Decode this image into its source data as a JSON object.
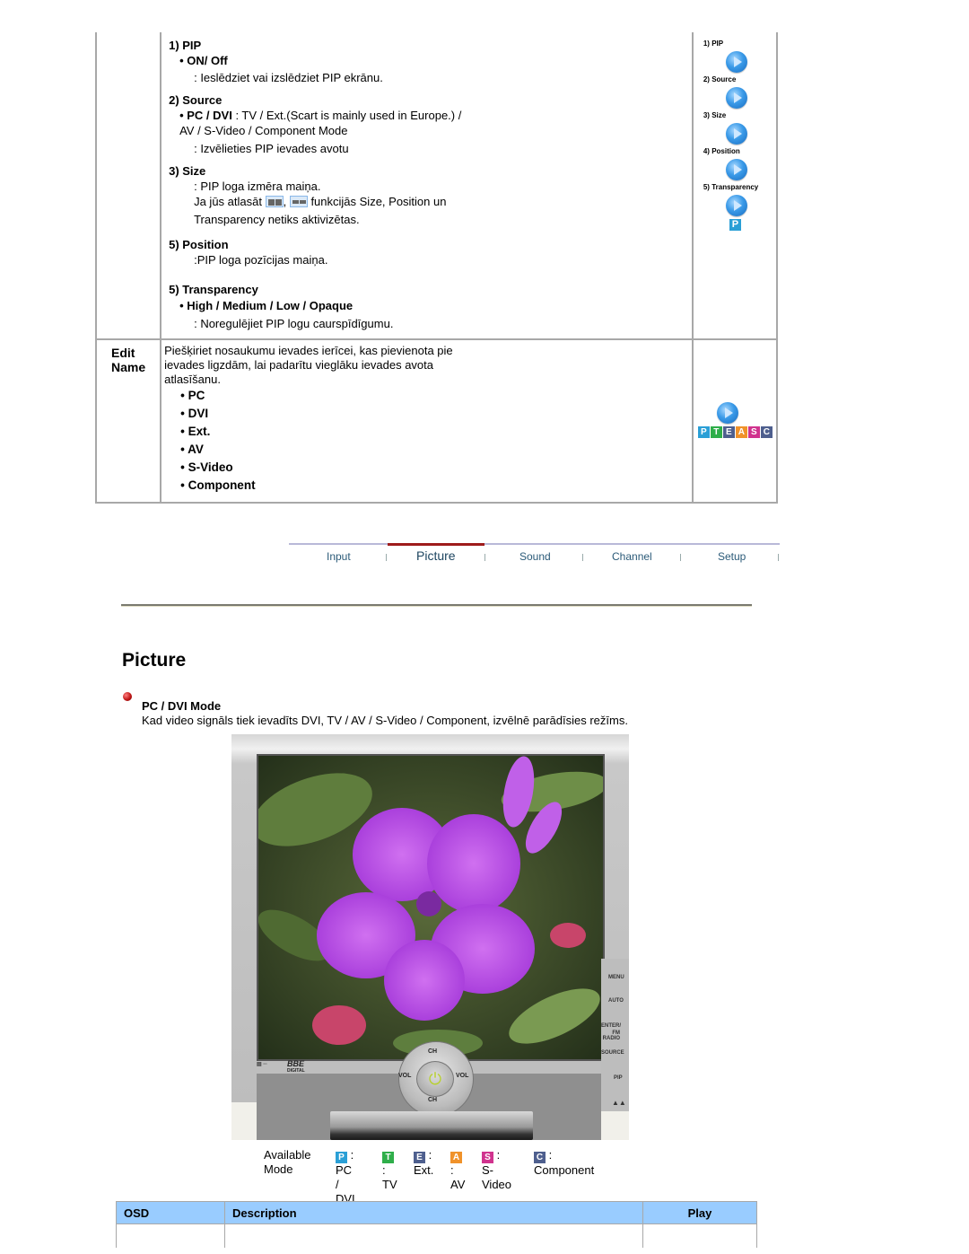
{
  "pip_table": {
    "rows": [
      {
        "label": "",
        "sections": {
          "pip": {
            "heading": "1) PIP",
            "option": "• ON/ Off",
            "desc": ": Ieslēdziet vai izslēdziet PIP ekrānu."
          },
          "source": {
            "heading": "2) Source",
            "option_bold": "• PC / DVI",
            "option_rest": " : TV / Ext.(Scart is mainly used in Europe.) /",
            "option_line2": "AV / S-Video / Component Mode",
            "desc": ": Izvēlieties PIP ievades avotu"
          },
          "size": {
            "heading": "3) Size",
            "desc": ": PIP loga izmēra maiņa.",
            "note_before": "Ja jūs atlasāt ",
            "note_sep": ", ",
            "note_after": " funkcijās Size, Position un",
            "note_line2": "Transparency netiks aktivizētas."
          },
          "position": {
            "heading": "5) Position",
            "desc": ":PIP loga pozīcijas maiņa."
          },
          "transparency": {
            "heading": "5) Transparency",
            "option": "• High / Medium / Low / Opaque",
            "desc": ": Noregulējiet PIP logu caurspīdīgumu."
          }
        },
        "play_links": [
          "1) PIP",
          "2) Source",
          "3) Size",
          "4) Position",
          "5) Transparency"
        ],
        "mode_badge": "P"
      },
      {
        "label_line1": "Edit",
        "label_line2": "Name",
        "text_line1": "Piešķiriet nosaukumu ievades ierīcei, kas pievienota pie",
        "text_line2": "ievades ligzdām, lai padarītu vieglāku ievades avota",
        "text_line3": "atlasīšanu.",
        "items": [
          "• PC",
          "• DVI",
          "• Ext.",
          "• AV",
          "• S-Video",
          "• Component"
        ],
        "mode_badges": [
          "P",
          "T",
          "E",
          "A",
          "S",
          "C"
        ]
      }
    ]
  },
  "nav": {
    "items": [
      "Input",
      "Picture",
      "Sound",
      "Channel",
      "Setup"
    ],
    "active": "Picture",
    "active_color": "#9e1b1b"
  },
  "page": {
    "title": "Picture",
    "section_heading": "PC / DVI Mode",
    "section_text": "Kad video signāls tiek ievadīts DVI, TV / AV / S-Video / Component, izvēlnē parādīsies režīms."
  },
  "tv": {
    "controls": {
      "ch_up": "CH",
      "ch_down": "CH",
      "vol_minus": "VOL",
      "vol_plus": "VOL",
      "power": "⏻"
    },
    "side_buttons": [
      "MENU",
      "AUTO",
      "ENTER/",
      "FM RADIO",
      "SOURCE",
      "PIP",
      "▲▲"
    ],
    "logos": [
      "BBE",
      "DIGITAL"
    ]
  },
  "available_mode": {
    "label_line1": "Available",
    "label_line2": "Mode",
    "modes": [
      {
        "badge": "P",
        "color": "#2a9fd6",
        "line1": " :",
        "line2": "PC /",
        "line3": "DVI"
      },
      {
        "badge": "T",
        "color": "#2fae4a",
        "line1": " :",
        "line2": "TV",
        "line3": ""
      },
      {
        "badge": "E",
        "color": "#4e5f8e",
        "line1": " :",
        "line2": "Ext.",
        "line3": ""
      },
      {
        "badge": "A",
        "color": "#f0922a",
        "line1": " :",
        "line2": "AV",
        "line3": ""
      },
      {
        "badge": "S",
        "color": "#d0338e",
        "line1": " : S-",
        "line2": "Video",
        "line3": ""
      },
      {
        "badge": "C",
        "color": "#4e5f8e",
        "line1": " :",
        "line2": "Component",
        "line3": ""
      }
    ]
  },
  "osd_table": {
    "headers": [
      "OSD",
      "Description",
      "Play"
    ],
    "header_color": "#99ccff"
  }
}
